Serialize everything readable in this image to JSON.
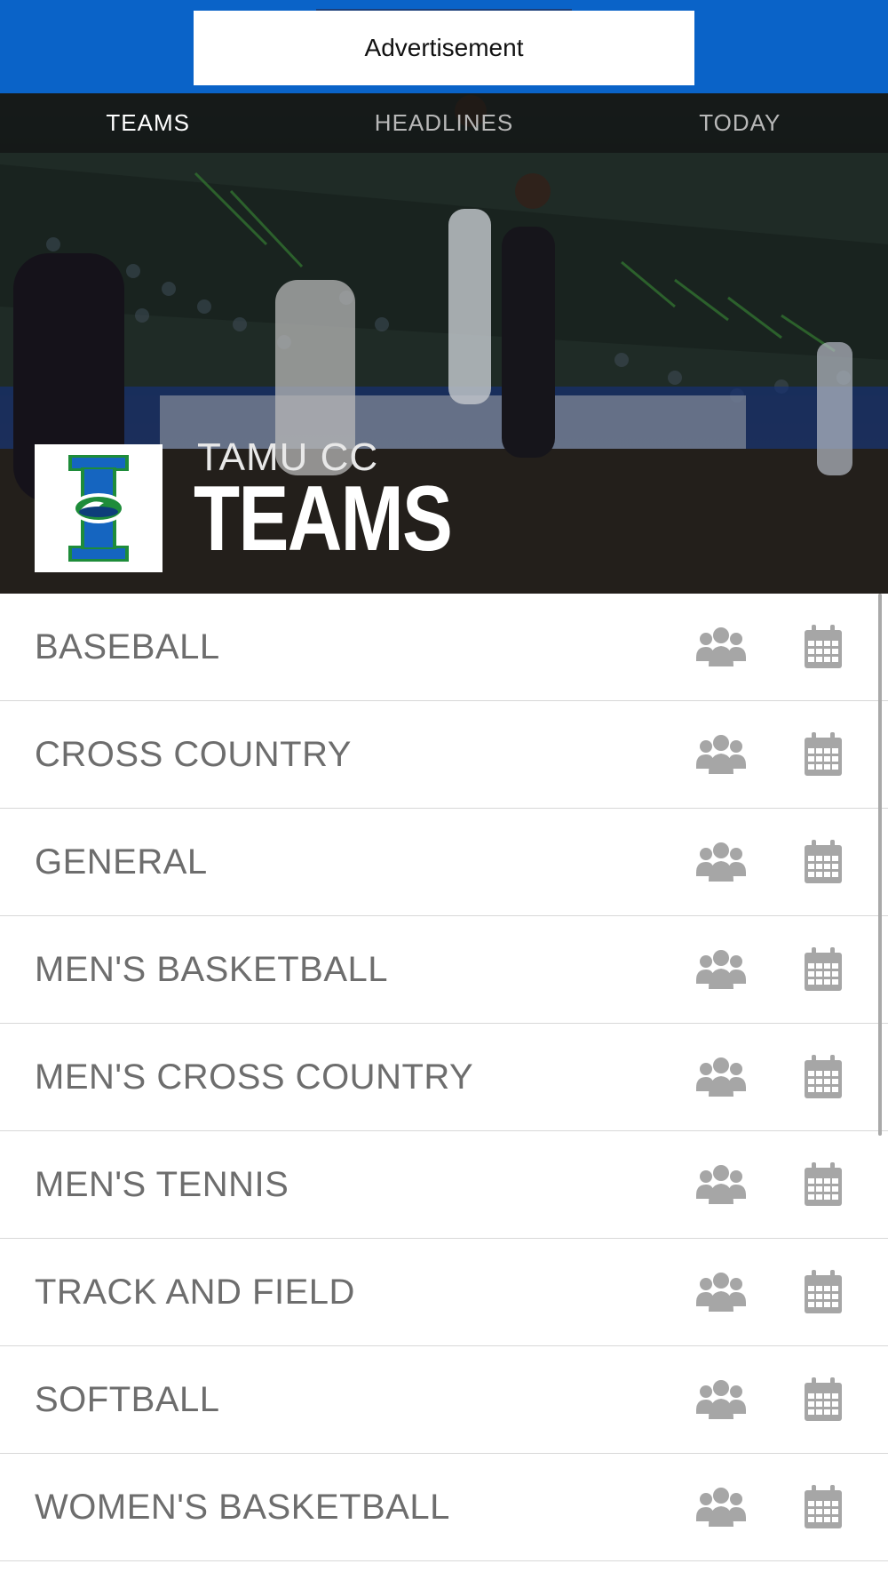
{
  "ad": {
    "label": "Advertisement"
  },
  "nav": {
    "tabs": [
      {
        "label": "TEAMS",
        "active": true
      },
      {
        "label": "HEADLINES",
        "active": false
      },
      {
        "label": "TODAY",
        "active": false
      }
    ]
  },
  "hero": {
    "subtitle": "TAMU CC",
    "title": "TEAMS",
    "logo_icon": "islanders-logo-icon"
  },
  "teams": [
    {
      "label": "BASEBALL",
      "roster_icon": "users-icon",
      "schedule_icon": "calendar-icon"
    },
    {
      "label": "CROSS COUNTRY",
      "roster_icon": "users-icon",
      "schedule_icon": "calendar-icon"
    },
    {
      "label": "GENERAL",
      "roster_icon": "users-icon",
      "schedule_icon": "calendar-icon"
    },
    {
      "label": "MEN'S BASKETBALL",
      "roster_icon": "users-icon",
      "schedule_icon": "calendar-icon"
    },
    {
      "label": "MEN'S CROSS COUNTRY",
      "roster_icon": "users-icon",
      "schedule_icon": "calendar-icon"
    },
    {
      "label": "MEN'S TENNIS",
      "roster_icon": "users-icon",
      "schedule_icon": "calendar-icon"
    },
    {
      "label": "TRACK AND FIELD",
      "roster_icon": "users-icon",
      "schedule_icon": "calendar-icon"
    },
    {
      "label": "SOFTBALL",
      "roster_icon": "users-icon",
      "schedule_icon": "calendar-icon"
    },
    {
      "label": "WOMEN'S BASKETBALL",
      "roster_icon": "users-icon",
      "schedule_icon": "calendar-icon"
    }
  ],
  "colors": {
    "ad_bar": "#0a63c8",
    "row_text": "#6d6d6d",
    "icon_gray": "#a6a6a6",
    "logo_blue": "#1565c0",
    "logo_green": "#1e8c3a"
  }
}
